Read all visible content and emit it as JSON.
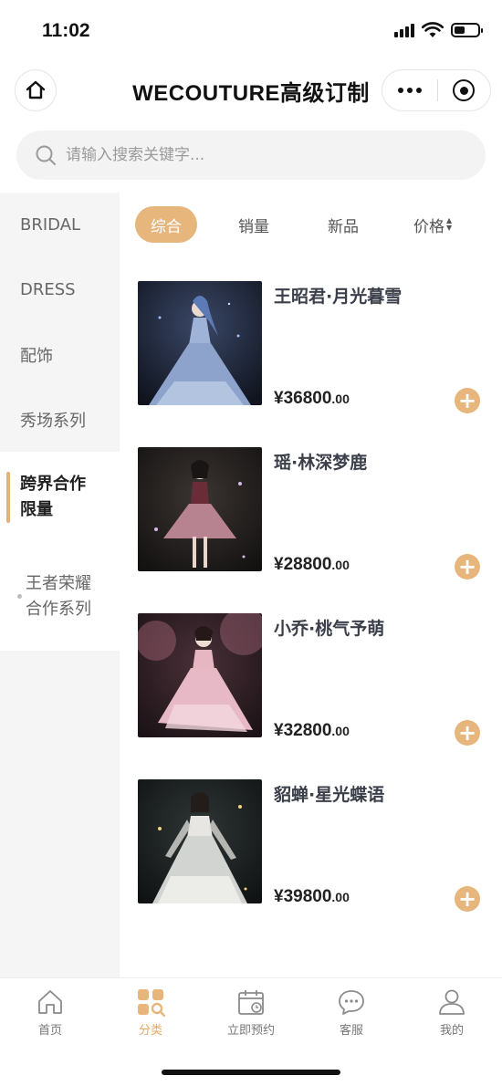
{
  "status": {
    "time": "11:02"
  },
  "header": {
    "title": "WECOUTURE高级订制"
  },
  "search": {
    "placeholder": "请输入搜索关键字..."
  },
  "sidebar": {
    "items": [
      {
        "label": "BRIDAL"
      },
      {
        "label": "DRESS"
      },
      {
        "label": "配饰"
      },
      {
        "label": "秀场系列"
      },
      {
        "label": "跨界合作\n限量"
      },
      {
        "label": "王者荣耀\n合作系列"
      }
    ]
  },
  "sort": {
    "tabs": [
      {
        "label": "综合"
      },
      {
        "label": "销量"
      },
      {
        "label": "新品"
      },
      {
        "label": "价格"
      }
    ]
  },
  "products": [
    {
      "name": "王昭君·月光暮雪",
      "price_int": "¥36800",
      "price_dec": ".00",
      "colors": [
        "#1b2233",
        "#7f93b8",
        "#c9d6ec"
      ]
    },
    {
      "name": "瑶·林深梦鹿",
      "price_int": "¥28800",
      "price_dec": ".00",
      "colors": [
        "#1b1a1a",
        "#6b2e38",
        "#c99aa6"
      ]
    },
    {
      "name": "小乔·桃气予萌",
      "price_int": "¥32800",
      "price_dec": ".00",
      "colors": [
        "#2a1c22",
        "#c98f9e",
        "#f2d4dc"
      ]
    },
    {
      "name": "貂蝉·星光蝶语",
      "price_int": "¥39800",
      "price_dec": ".00",
      "colors": [
        "#141a1e",
        "#b9c0c3",
        "#eff0ee"
      ]
    }
  ],
  "tabbar": {
    "items": [
      {
        "label": "首页",
        "icon": "home-icon"
      },
      {
        "label": "分类",
        "icon": "category-icon"
      },
      {
        "label": "立即预约",
        "icon": "calendar-icon"
      },
      {
        "label": "客服",
        "icon": "chat-icon"
      },
      {
        "label": "我的",
        "icon": "user-icon"
      }
    ]
  },
  "theme": {
    "accent": "#e6b67d"
  }
}
